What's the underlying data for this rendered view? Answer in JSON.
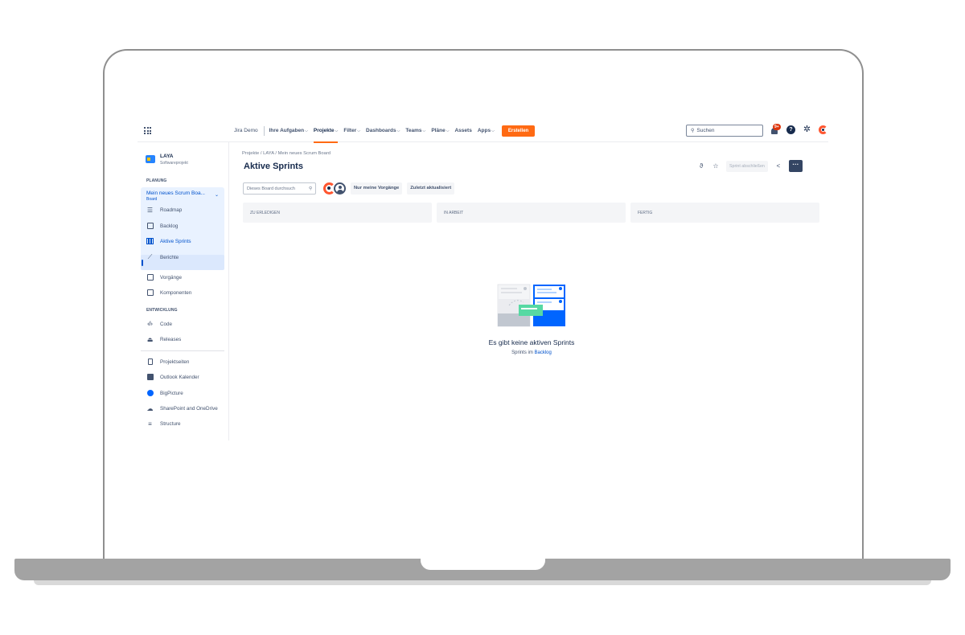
{
  "topnav": {
    "home": "Jira Demo",
    "items": [
      {
        "label": "Ihre Aufgaben",
        "chevron": true
      },
      {
        "label": "Projekte",
        "chevron": true,
        "active": true
      },
      {
        "label": "Filter",
        "chevron": true
      },
      {
        "label": "Dashboards",
        "chevron": true
      },
      {
        "label": "Teams",
        "chevron": true
      },
      {
        "label": "Pläne",
        "chevron": true
      },
      {
        "label": "Assets",
        "chevron": false
      },
      {
        "label": "Apps",
        "chevron": true
      }
    ],
    "create_label": "Erstellen",
    "search_label": "Suchen",
    "notifications_badge": "9+",
    "accent_color": "#ff6a13"
  },
  "sidebar": {
    "project_name": "LAYA",
    "project_type": "Softwareprojekt",
    "planning_label": "PLANUNG",
    "board_name": "Mein neues Scrum Boa...",
    "board_type": "Board",
    "items": [
      {
        "label": "Roadmap",
        "icon": "roadmap-icon"
      },
      {
        "label": "Backlog",
        "icon": "backlog-icon"
      },
      {
        "label": "Aktive Sprints",
        "icon": "board-columns-icon",
        "active": true
      },
      {
        "label": "Berichte",
        "icon": "reports-icon"
      },
      {
        "label": "Vorgänge",
        "icon": "issues-icon"
      },
      {
        "label": "Komponenten",
        "icon": "components-icon"
      }
    ],
    "dev_label": "ENTWICKLUNG",
    "dev_items": [
      {
        "label": "Code",
        "icon": "code-icon"
      },
      {
        "label": "Releases",
        "icon": "ship-icon"
      }
    ],
    "extra_items": [
      {
        "label": "Projektseiten",
        "icon": "page-icon"
      },
      {
        "label": "Outlook Kalender",
        "icon": "outlook-icon"
      },
      {
        "label": "BigPicture",
        "icon": "bigpicture-icon"
      },
      {
        "label": "SharePoint and OneDrive",
        "icon": "cloud-icon"
      },
      {
        "label": "Structure",
        "icon": "structure-icon"
      }
    ]
  },
  "main": {
    "breadcrumb": "Projekte  /  LAYA  /  Mein neues Scrum Board",
    "title": "Aktive Sprints",
    "complete_sprint_label": "Sprint abschließen",
    "more_label": "···",
    "search_placeholder": "Dieses Board durchsuch",
    "filter_only_mine": "Nur meine Vorgänge",
    "filter_recent": "Zuletzt aktualisiert",
    "columns": [
      "ZU ERLEDIGEN",
      "IN ARBEIT",
      "FERTIG"
    ],
    "empty_title": "Es gibt keine aktiven Sprints",
    "empty_sub_prefix": "Sprints im ",
    "empty_sub_link": "Backlog"
  }
}
